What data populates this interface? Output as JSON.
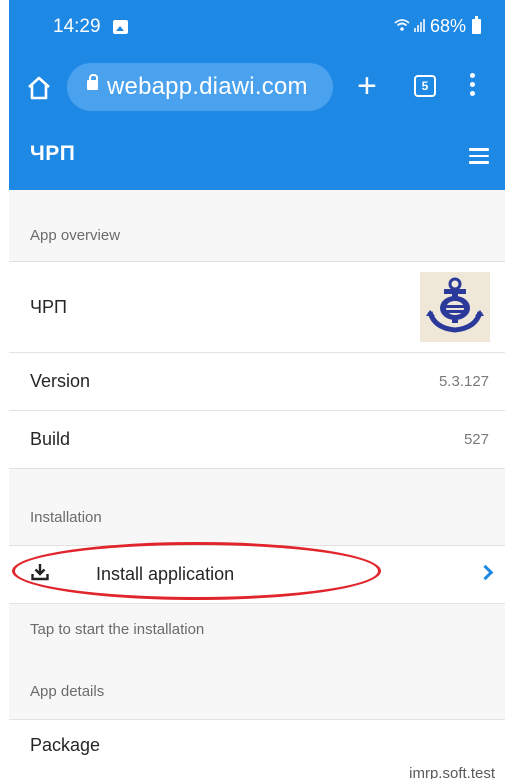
{
  "status_bar": {
    "time": "14:29",
    "battery": "68%"
  },
  "browser": {
    "url": "webapp.diawi.com",
    "tab_count": "5"
  },
  "app_bar": {
    "title": "ЧРП"
  },
  "overview": {
    "header": "App overview",
    "app_name": "ЧРП",
    "version_label": "Version",
    "version_value": "5.3.127",
    "build_label": "Build",
    "build_value": "527"
  },
  "installation": {
    "header": "Installation",
    "install_label": "Install application",
    "hint": "Tap to start the installation"
  },
  "details": {
    "header": "App details",
    "package_label": "Package",
    "package_value": "imrp.soft.test"
  },
  "colors": {
    "accent": "#1e88e5",
    "url_pill": "#4aa1ee",
    "annotation": "#e0262c",
    "logo": "#2b3a9a"
  },
  "icons": [
    "image-icon",
    "wifi-icon",
    "signal-icon",
    "battery-icon",
    "home-icon",
    "lock-icon",
    "plus-icon",
    "tabs-icon",
    "menu-dots-icon",
    "hamburger-icon",
    "download-icon",
    "chevron-right-icon",
    "anchor-logo-icon"
  ]
}
